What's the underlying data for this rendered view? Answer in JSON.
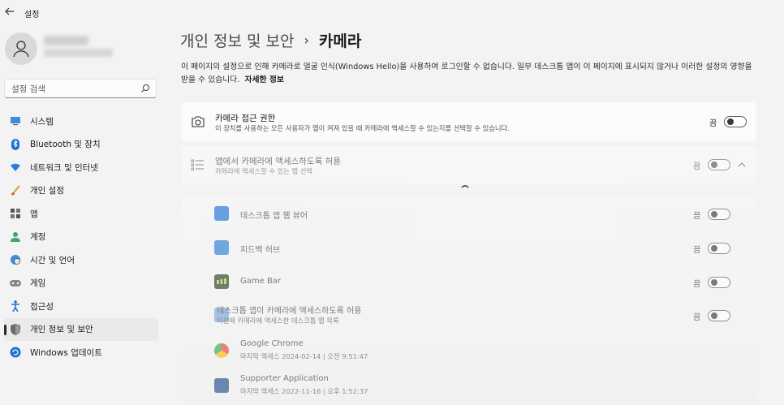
{
  "window": {
    "title": "설정"
  },
  "sidebar": {
    "search_placeholder": "설정 검색",
    "items": [
      {
        "label": "시스템",
        "icon": "monitor-icon"
      },
      {
        "label": "Bluetooth 및 장치",
        "icon": "bluetooth-icon"
      },
      {
        "label": "네트워크 및 인터넷",
        "icon": "wifi-icon"
      },
      {
        "label": "개인 설정",
        "icon": "brush-icon"
      },
      {
        "label": "앱",
        "icon": "apps-icon"
      },
      {
        "label": "계정",
        "icon": "person-icon"
      },
      {
        "label": "시간 및 언어",
        "icon": "globe-clock-icon"
      },
      {
        "label": "게임",
        "icon": "gamepad-icon"
      },
      {
        "label": "접근성",
        "icon": "accessibility-icon"
      },
      {
        "label": "개인 정보 및 보안",
        "icon": "shield-icon",
        "active": true
      },
      {
        "label": "Windows 업데이트",
        "icon": "update-icon"
      }
    ]
  },
  "breadcrumb": {
    "parent": "개인 정보 및 보안",
    "separator": "›",
    "current": "카메라"
  },
  "description": {
    "text": "이 페이지의 설정으로 인해 카메라로 얼굴 인식(Windows Hello)을 사용하여 로그인할 수 없습니다. 일부 데스크톱 앱이 이 페이지에 표시되지 않거나 이러한 설정의 영향을 받을 수 있습니다.",
    "link": "자세한 정보"
  },
  "camera_access": {
    "title": "카메라 접근 권한",
    "subtitle": "이 장치를 사용하는 모든 사용자가 앱이 켜져 있을 때 카메라에 액세스할 수 있는지를 선택할 수 있습니다.",
    "state_label": "끔"
  },
  "app_access": {
    "title": "앱에서 카메라에 액세스하도록 허용",
    "subtitle": "카메라에 액세스할 수 있는 앱 선택",
    "state_label": "끔"
  },
  "apps": [
    {
      "name": "데스크톱 앱 웹 뷰어",
      "state_label": "끔",
      "color": "#1e73d8"
    },
    {
      "name": "피드백 허브",
      "state_label": "끔",
      "color": "#2a7fd4"
    },
    {
      "name": "Game Bar",
      "state_label": "끔",
      "color": "#2f3a2a"
    }
  ],
  "desktop_apps": {
    "title": "데스크톱 앱이 카메라에 액세스하도록 허용",
    "subtitle": "이전에 카메라에 액세스한 데스크톱 앱 목록",
    "state_label": "끔",
    "items": [
      {
        "name": "Google Chrome",
        "last_access": "마지막 액세스 2024-02-14 | 오전 9:51:47"
      },
      {
        "name": "Supporter Application",
        "last_access": "마지막 액세스 2022-11-16 | 오후 1:52:37"
      }
    ]
  }
}
